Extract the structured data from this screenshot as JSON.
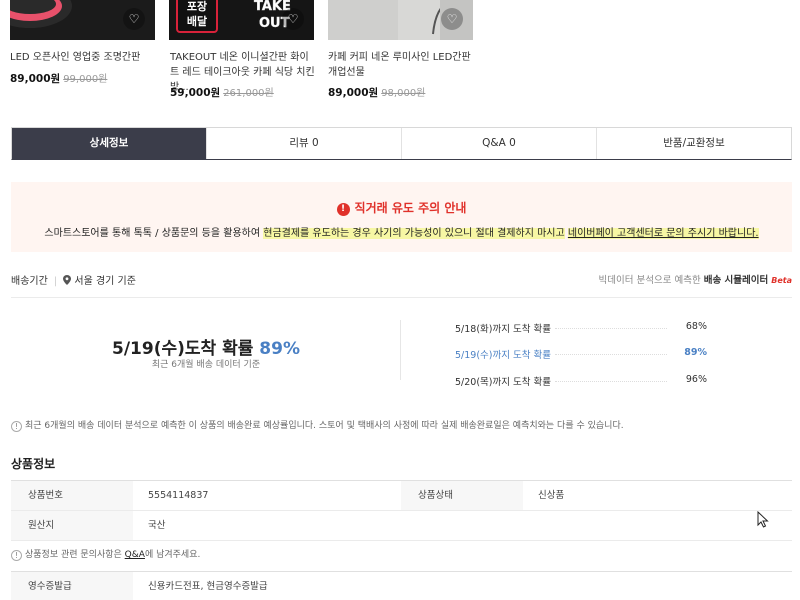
{
  "related_products": [
    {
      "name": "LED 오픈사인 영업중 조명간판",
      "price": "89,000원",
      "original_price": "99,000원",
      "thumb_colors": [
        "#1b1b1b",
        "#e8516b"
      ],
      "icon": "heart-icon"
    },
    {
      "name": "TAKEOUT 네온 이니셜간판 화이트 레드 테이크아웃 카페 식당 치킨 방...",
      "price": "59,000원",
      "original_price": "261,000원",
      "thumb_text_left": "포장배달",
      "thumb_text_right": "TAKE OUT",
      "icon": "heart-icon"
    },
    {
      "name": "카페 커피 네온 루미사인 LED간판 개업선물",
      "price": "89,000원",
      "original_price": "98,000원",
      "thumb_colors": [
        "#d8d8d6",
        "#bcbcba"
      ],
      "icon": "heart-icon"
    }
  ],
  "tabs": [
    {
      "label": "상세정보",
      "active": true
    },
    {
      "label": "리뷰 0",
      "active": false
    },
    {
      "label": "Q&A 0",
      "active": false
    },
    {
      "label": "반품/교환정보",
      "active": false
    }
  ],
  "notice": {
    "title": "직거래 유도 주의 안내",
    "icon": "exclamation-icon",
    "body_prefix": "스마트스토어를 통해 톡톡 / 상품문의 등을 활용하여 ",
    "body_highlight": "현금결제를 유도하는 경우 사기의 가능성이 있으니 절대 결제하지 마시고",
    "body_middle": " ",
    "body_link": "네이버페이 고객센터로 문의 주시기 바랍니다."
  },
  "delivery": {
    "label": "배송기간",
    "location_icon": "map-pin-icon",
    "location": "서울 경기 기준",
    "analysis_prefix": "빅데이터 분석으로 예측한",
    "analysis_bold": "배송 시뮬레이터",
    "beta": "Beta",
    "headline_date": "5/19(수)도착 확률",
    "headline_pct": "89%",
    "subtext": "최근 6개월 배송 데이터 기준",
    "rows": [
      {
        "label": "5/18(화)까지 도착 확률",
        "value": "68%",
        "highlight": false
      },
      {
        "label": "5/19(수)까지 도착 확률",
        "value": "89%",
        "highlight": true
      },
      {
        "label": "5/20(목)까지 도착 확률",
        "value": "96%",
        "highlight": false
      }
    ],
    "note": "최근 6개월의 배송 데이터 분석으로 예측한 이 상품의 배송완료 예상률입니다. 스토어 및 택배사의 사정에 따라 실제 배송완료일은 예측치와는 다를 수 있습니다."
  },
  "product_info": {
    "title": "상품정보",
    "rows": [
      {
        "label": "상품번호",
        "value": "5554114837",
        "label2": "상품상태",
        "value2": "신상품"
      },
      {
        "label": "원산지",
        "value": "국산"
      }
    ],
    "note_prefix": "상품정보 관련 문의사항은 ",
    "note_link": "Q&A",
    "note_suffix": "에 남겨주세요.",
    "receipt_label": "영수증발급",
    "receipt_value": "신용카드전표, 현금영수증발급"
  },
  "colors": {
    "tab_active": "#3b3d4a",
    "alert": "#e0312a",
    "accent_blue": "#4a80c4",
    "notice_bg": "#fff5f1",
    "highlight": "#f7f7a4"
  }
}
